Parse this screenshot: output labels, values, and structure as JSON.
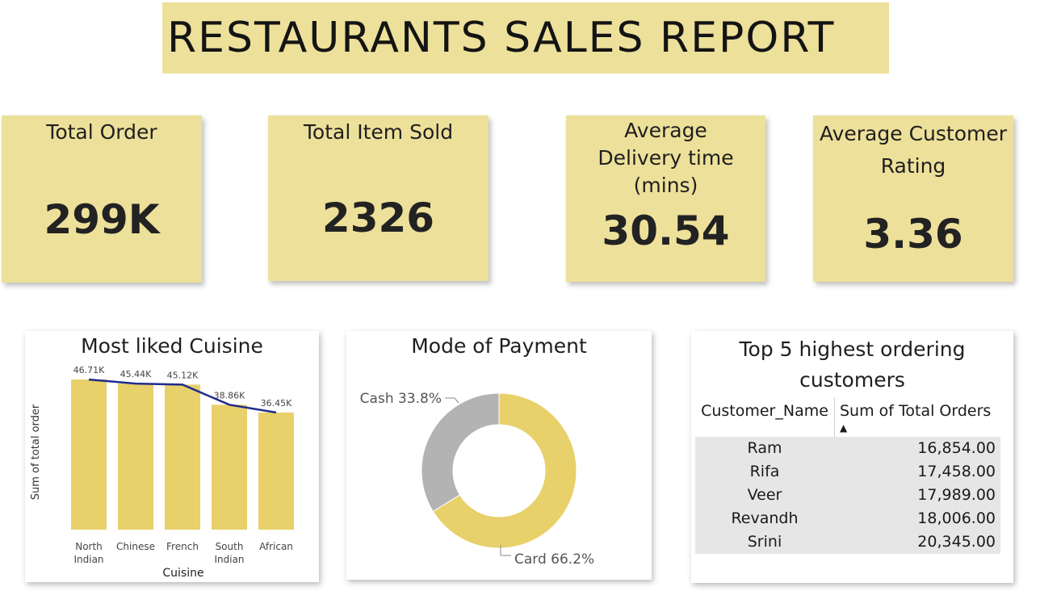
{
  "title": "RESTAURANTS SALES REPORT",
  "kpis": [
    {
      "label": "Total Order",
      "value": "299K"
    },
    {
      "label": "Total Item Sold",
      "value": "2326"
    },
    {
      "label": "Average Delivery time (mins)",
      "value": "30.54"
    },
    {
      "label": "Average Customer Rating",
      "value": "3.36"
    }
  ],
  "colors": {
    "card": "#ede09a",
    "bar": "#e8d06a",
    "line": "#1f2b8c",
    "cash": "#b3b3b3",
    "card_slice": "#e8d06a",
    "table_row": "#e6e6e6"
  },
  "chart_data": [
    {
      "type": "bar",
      "title": "Most liked Cuisine",
      "categories": [
        "North Indian",
        "Chinese",
        "French",
        "South Indian",
        "African"
      ],
      "values": [
        46710,
        45440,
        45120,
        38860,
        36450
      ],
      "data_labels": [
        "46.71K",
        "45.44K",
        "45.12K",
        "38.86K",
        "36.45K"
      ],
      "xlabel": "Cuisine",
      "ylabel": "Sum of total order",
      "ylim": [
        0,
        50000
      ],
      "overlay_line": true,
      "grid": false
    },
    {
      "type": "pie",
      "title": "Mode of Payment",
      "donut": true,
      "slices": [
        {
          "name": "Card",
          "value": 66.2,
          "label": "Card 66.2%"
        },
        {
          "name": "Cash",
          "value": 33.8,
          "label": "Cash 33.8%"
        }
      ]
    },
    {
      "type": "table",
      "title": "Top 5 highest ordering customers",
      "columns": [
        "Customer_Name",
        "Sum of Total Orders"
      ],
      "sort_indicator": "▲",
      "rows": [
        [
          "Ram",
          "16,854.00"
        ],
        [
          "Rifa",
          "17,458.00"
        ],
        [
          "Veer",
          "17,989.00"
        ],
        [
          "Revandh",
          "18,006.00"
        ],
        [
          "Srini",
          "20,345.00"
        ]
      ]
    }
  ]
}
